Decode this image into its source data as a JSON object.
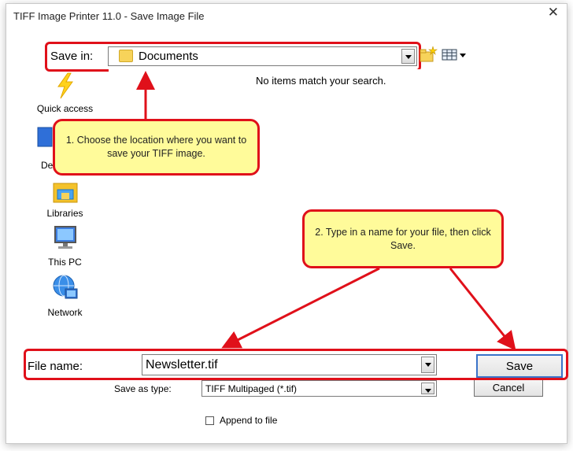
{
  "window": {
    "title": "TIFF Image Printer 11.0 - Save Image File",
    "close_glyph": "✕"
  },
  "save_in": {
    "label": "Save in:",
    "value": "Documents"
  },
  "file_list": {
    "empty_message": "No items match your search."
  },
  "places": [
    {
      "label": "Quick access",
      "icon": "quick-access-icon"
    },
    {
      "label": "De",
      "icon": "desktop-icon"
    },
    {
      "label": "Libraries",
      "icon": "libraries-icon"
    },
    {
      "label": "This PC",
      "icon": "this-pc-icon"
    },
    {
      "label": "Network",
      "icon": "network-icon"
    }
  ],
  "callouts": {
    "location": "1. Choose the location where you want to save your TIFF image.",
    "filename": "2. Type in a name for your file, then click Save."
  },
  "file_name": {
    "label": "File name:",
    "value": "Newsletter.tif"
  },
  "save_as_type": {
    "label": "Save as type:",
    "value": "TIFF Multipaged (*.tif)"
  },
  "buttons": {
    "save": "Save",
    "cancel": "Cancel"
  },
  "append": {
    "label": "Append to file",
    "checked": false
  },
  "colors": {
    "annotation_red": "#e0101a",
    "callout_fill": "#fffb9a"
  }
}
